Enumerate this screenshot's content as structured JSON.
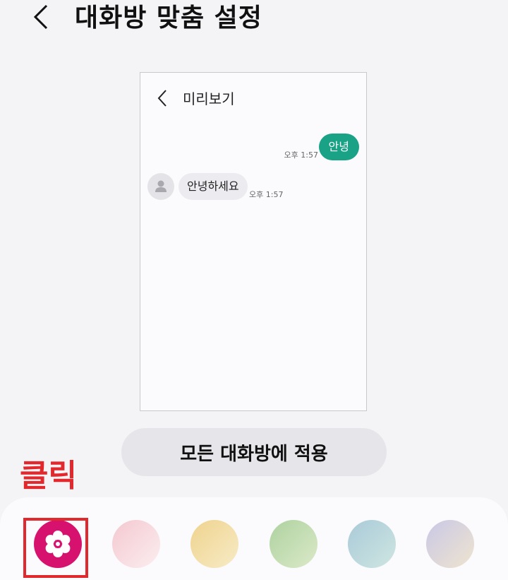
{
  "header": {
    "title": "대화방 맞춤 설정",
    "back_icon": "chevron-left-icon"
  },
  "preview": {
    "title": "미리보기",
    "back_icon": "chevron-left-icon",
    "sent_message": {
      "text": "안녕",
      "time": "오후 1:57",
      "color": "#1aa287"
    },
    "received_message": {
      "text": "안녕하세요",
      "time": "오후 1:57",
      "avatar_icon": "person-icon"
    }
  },
  "apply_button": {
    "label": "모든 대화방에 적용"
  },
  "annotation": {
    "text": "클릭",
    "color": "#e0282d"
  },
  "themes": [
    {
      "name": "flower",
      "icon": "flower-icon",
      "color": "#d6126e",
      "selected": true
    },
    {
      "name": "pink",
      "color": "#f4c8d0"
    },
    {
      "name": "yellow",
      "color": "#efd38e"
    },
    {
      "name": "green",
      "color": "#aed2a0"
    },
    {
      "name": "teal",
      "color": "#a9cad8"
    },
    {
      "name": "lavender",
      "color": "#c9c8e6"
    }
  ]
}
